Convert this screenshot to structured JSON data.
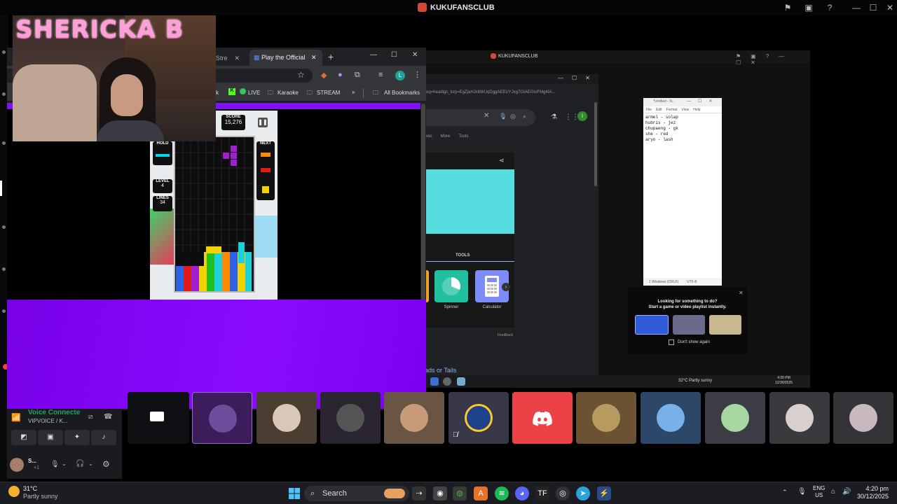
{
  "app": {
    "title": "KUKUFANSCLUB"
  },
  "colors": {
    "discord": "#ed4245",
    "purple": "#8a0bff",
    "dark": "#1f1f22"
  },
  "streamer": {
    "name": "SHERICKA B"
  },
  "chrome": {
    "tabs": [
      {
        "label": "Stre"
      },
      {
        "label": "Play the Official"
      }
    ],
    "bookmarks": [
      {
        "label": "ck"
      },
      {
        "label": "LIVE"
      },
      {
        "label": "Karaoke"
      },
      {
        "label": "STREAM"
      },
      {
        "label": "All Bookmarks"
      }
    ],
    "profile_initial": "L"
  },
  "tetris": {
    "score_label": "SCORE",
    "score": "15,276",
    "hold_label": "HOLD",
    "next_label": "NEXT",
    "level_label": "LEVEL",
    "level": "4",
    "lines_label": "LINES",
    "lines": "34"
  },
  "nested": {
    "title": "KUKUFANSCLUB",
    "url": "oq=headlgs_lcrp=EgZjaHJvbWUqDggAEEUYJxg7GIAEGIoFMg4IA...",
    "filters": [
      "ews",
      "More",
      "Tools"
    ],
    "tools_label": "TOOLS",
    "tools": [
      {
        "label": "Spinner"
      },
      {
        "label": "Calculator"
      }
    ],
    "feedback": "Feedback",
    "heads_tails": "ads or Tails",
    "account_initial": "i",
    "weather": "32°C Partly sunny",
    "time": "4:20 PM",
    "date": "12/30/2025"
  },
  "notepad": {
    "title": "*Untitled - N...",
    "menu": [
      "File",
      "Edit",
      "Format",
      "View",
      "Help"
    ],
    "lines": [
      "armel - solap",
      "hubris - jez",
      "chupaeng - gk",
      "she - red",
      "aryo - lash"
    ],
    "status_eol": "1 Windows (CRLF)",
    "status_enc": "UTF-8"
  },
  "activity": {
    "heading": "Looking for something to do?",
    "sub": "Start a game or video playlist instantly.",
    "checkbox": "Don't show again"
  },
  "voice": {
    "status": "Voice Connecte",
    "channel": "VIPVOICE / K...",
    "user": "S...",
    "user_sub": "+1"
  },
  "taskbar": {
    "weather_temp": "31°C",
    "weather_desc": "Partly sunny",
    "search": "Search",
    "lang": "ENG",
    "region": "US",
    "time": "4:20 pm",
    "date": "30/12/2025"
  }
}
